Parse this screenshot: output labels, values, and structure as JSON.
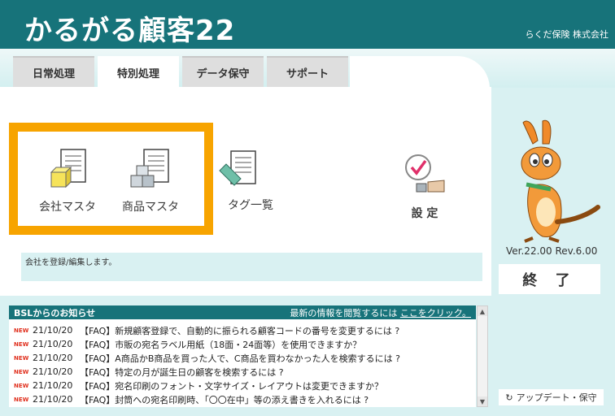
{
  "header": {
    "app_title": "かるがる顧客22",
    "company": "らくだ保険 株式会社"
  },
  "tabs": [
    {
      "label": "日常処理",
      "active": false
    },
    {
      "label": "特別処理",
      "active": true
    },
    {
      "label": "データ保守",
      "active": false
    },
    {
      "label": "サポート",
      "active": false
    }
  ],
  "menu": {
    "company_master": "会社マスタ",
    "product_master": "商品マスタ",
    "tag_list": "タグ一覧",
    "settings": "設 定"
  },
  "description": "会社を登録/編集します。",
  "version": "Ver.22.00 Rev.6.00",
  "exit_label": "終 了",
  "update_label": "アップデート・保守",
  "news": {
    "title": "BSLからのお知らせ",
    "more_text": "最新の情報を閲覧するには",
    "more_link": "ここをクリック。",
    "items": [
      {
        "badge": "NEW",
        "date": "21/10/20",
        "text": "【FAQ】新規顧客登録で、自動的に振られる顧客コードの番号を変更するには ?"
      },
      {
        "badge": "NEW",
        "date": "21/10/20",
        "text": "【FAQ】市販の宛名ラベル用紙（18面・24面等）を使用できますか？"
      },
      {
        "badge": "NEW",
        "date": "21/10/20",
        "text": "【FAQ】A商品かB商品を買った人で、C商品を買わなかった人を検索するには ?"
      },
      {
        "badge": "NEW",
        "date": "21/10/20",
        "text": "【FAQ】特定の月が誕生日の顧客を検索するには ?"
      },
      {
        "badge": "NEW",
        "date": "21/10/20",
        "text": "【FAQ】宛名印刷のフォント・文字サイズ・レイアウトは変更できますか？"
      },
      {
        "badge": "NEW",
        "date": "21/10/20",
        "text": "【FAQ】封筒への宛名印刷時、「〇〇在中」等の添え書きを入れるには ?"
      }
    ]
  },
  "colors": {
    "header": "#17737a",
    "background": "#d9f1f2",
    "highlight": "#f7a400",
    "new_badge": "#e0301e"
  }
}
